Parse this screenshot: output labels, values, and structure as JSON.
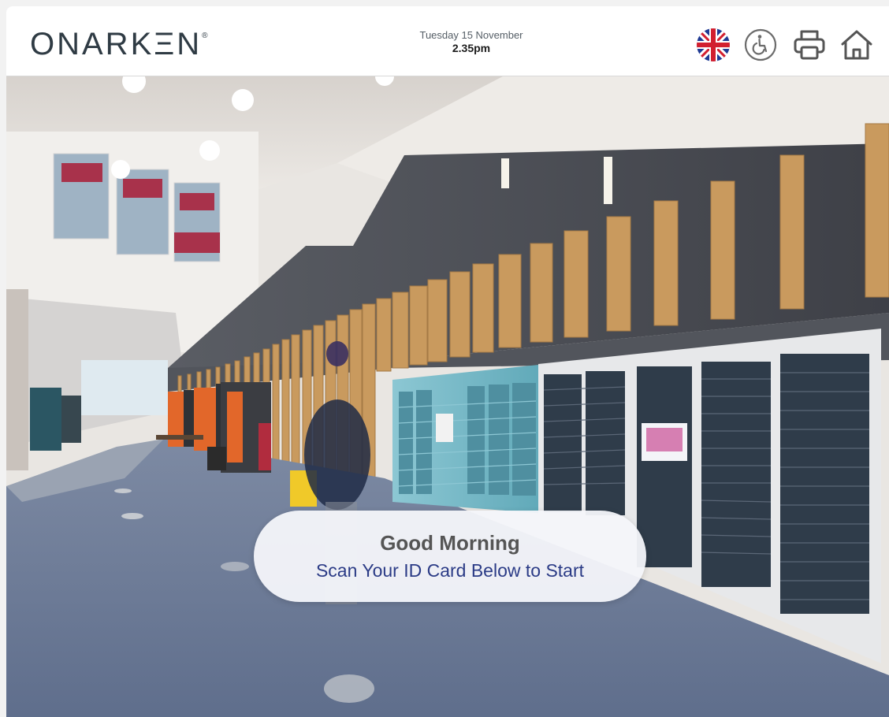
{
  "brand": {
    "logo_text": "ONARKΞN",
    "trademark": "®"
  },
  "header": {
    "date": "Tuesday 15 November",
    "time": "2.35pm"
  },
  "toolbar": {
    "language_icon": "uk-flag-icon",
    "accessibility_icon": "wheelchair-icon",
    "print_icon": "printer-icon",
    "home_icon": "home-icon"
  },
  "banner": {
    "greeting": "Good Morning",
    "instruction": "Scan Your ID Card Below to Start"
  },
  "colors": {
    "logo": "#2f3b44",
    "instruction_text": "#2b3b86",
    "greeting_text": "#555555",
    "carpet": "#6b7b98",
    "locker_teal": "#6fb5c4",
    "locker_dark": "#2f3c4a",
    "wood_fins": "#c99a5e",
    "wall_dark": "#4c4f57"
  }
}
